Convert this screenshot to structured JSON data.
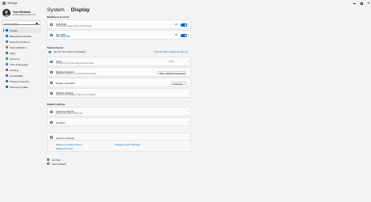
{
  "window": {
    "title": "Settings",
    "controls": [
      "minimize-icon",
      "maximize-icon",
      "close-icon"
    ]
  },
  "profile": {
    "name": "Your Windows",
    "email": "windows@example.com"
  },
  "search": {
    "placeholder": "Find a setting",
    "value": ""
  },
  "nav": {
    "items": [
      {
        "label": "System",
        "icon": "system-icon",
        "color": "#0067c0",
        "active": true
      },
      {
        "label": "Bluetooth & devices",
        "icon": "bluetooth-icon",
        "color": "#0078d4",
        "active": false
      },
      {
        "label": "Network & internet",
        "icon": "network-icon",
        "color": "#4a7fb5",
        "active": false
      },
      {
        "label": "Personalization",
        "icon": "personalization-icon",
        "color": "#c46a28",
        "active": false
      },
      {
        "label": "Apps",
        "icon": "apps-icon",
        "color": "#6b6b8a",
        "active": false
      },
      {
        "label": "Accounts",
        "icon": "accounts-icon",
        "color": "#2e9e6a",
        "active": false
      },
      {
        "label": "Time & language",
        "icon": "time-language-icon",
        "color": "#3a86c8",
        "active": false
      },
      {
        "label": "Gaming",
        "icon": "gaming-icon",
        "color": "#6f6f6f",
        "active": false
      },
      {
        "label": "Accessibility",
        "icon": "accessibility-icon",
        "color": "#3b6fb6",
        "active": false
      },
      {
        "label": "Privacy & security",
        "icon": "privacy-security-icon",
        "color": "#6d6d6d",
        "active": false
      },
      {
        "label": "Windows Update",
        "icon": "windows-update-icon",
        "color": "#0a6cc2",
        "active": false
      }
    ]
  },
  "main": {
    "breadcrumb_parent": "System",
    "breadcrumb_separator": "›",
    "breadcrumb_current": "Display",
    "brightness_section": {
      "title": "Brightness & colour",
      "night_light": {
        "title": "Night light",
        "subtitle": "Use warmer colours to help block blue light",
        "state": "On"
      },
      "hdr": {
        "title": "Use HDR",
        "subtitle": "More about HDR",
        "state": "On"
      }
    },
    "scale_section": {
      "title": "Scale & layout",
      "same_settings_label": "Use the same scale on all displays",
      "same_settings_link": "Turn off custom scaling and sign out",
      "scale": {
        "title": "Scale",
        "subtitle": "Change the size of text, apps and other items",
        "value": "100%"
      },
      "resolution": {
        "title": "Display resolution",
        "subtitle": "Adjust the resolution to fit your connected display",
        "value": "2560 × 1440 (Recommended)"
      },
      "orientation": {
        "title": "Display orientation",
        "value": "Landscape"
      },
      "multiple_displays": {
        "title": "Multiple displays",
        "subtitle": "Choose the presentation mode for your displays"
      }
    },
    "related_section": {
      "title": "Related settings",
      "advanced_display": {
        "title": "Advanced display",
        "subtitle": "Display information, refresh rate"
      },
      "graphics": {
        "title": "Graphics"
      }
    },
    "help": {
      "title": "Help from Display",
      "links": [
        "Setting up multiple monitors",
        "Changing screen brightness",
        "Adjusting font size"
      ]
    },
    "footer": {
      "get_help": "Get help",
      "feedback": "Give feedback"
    }
  }
}
